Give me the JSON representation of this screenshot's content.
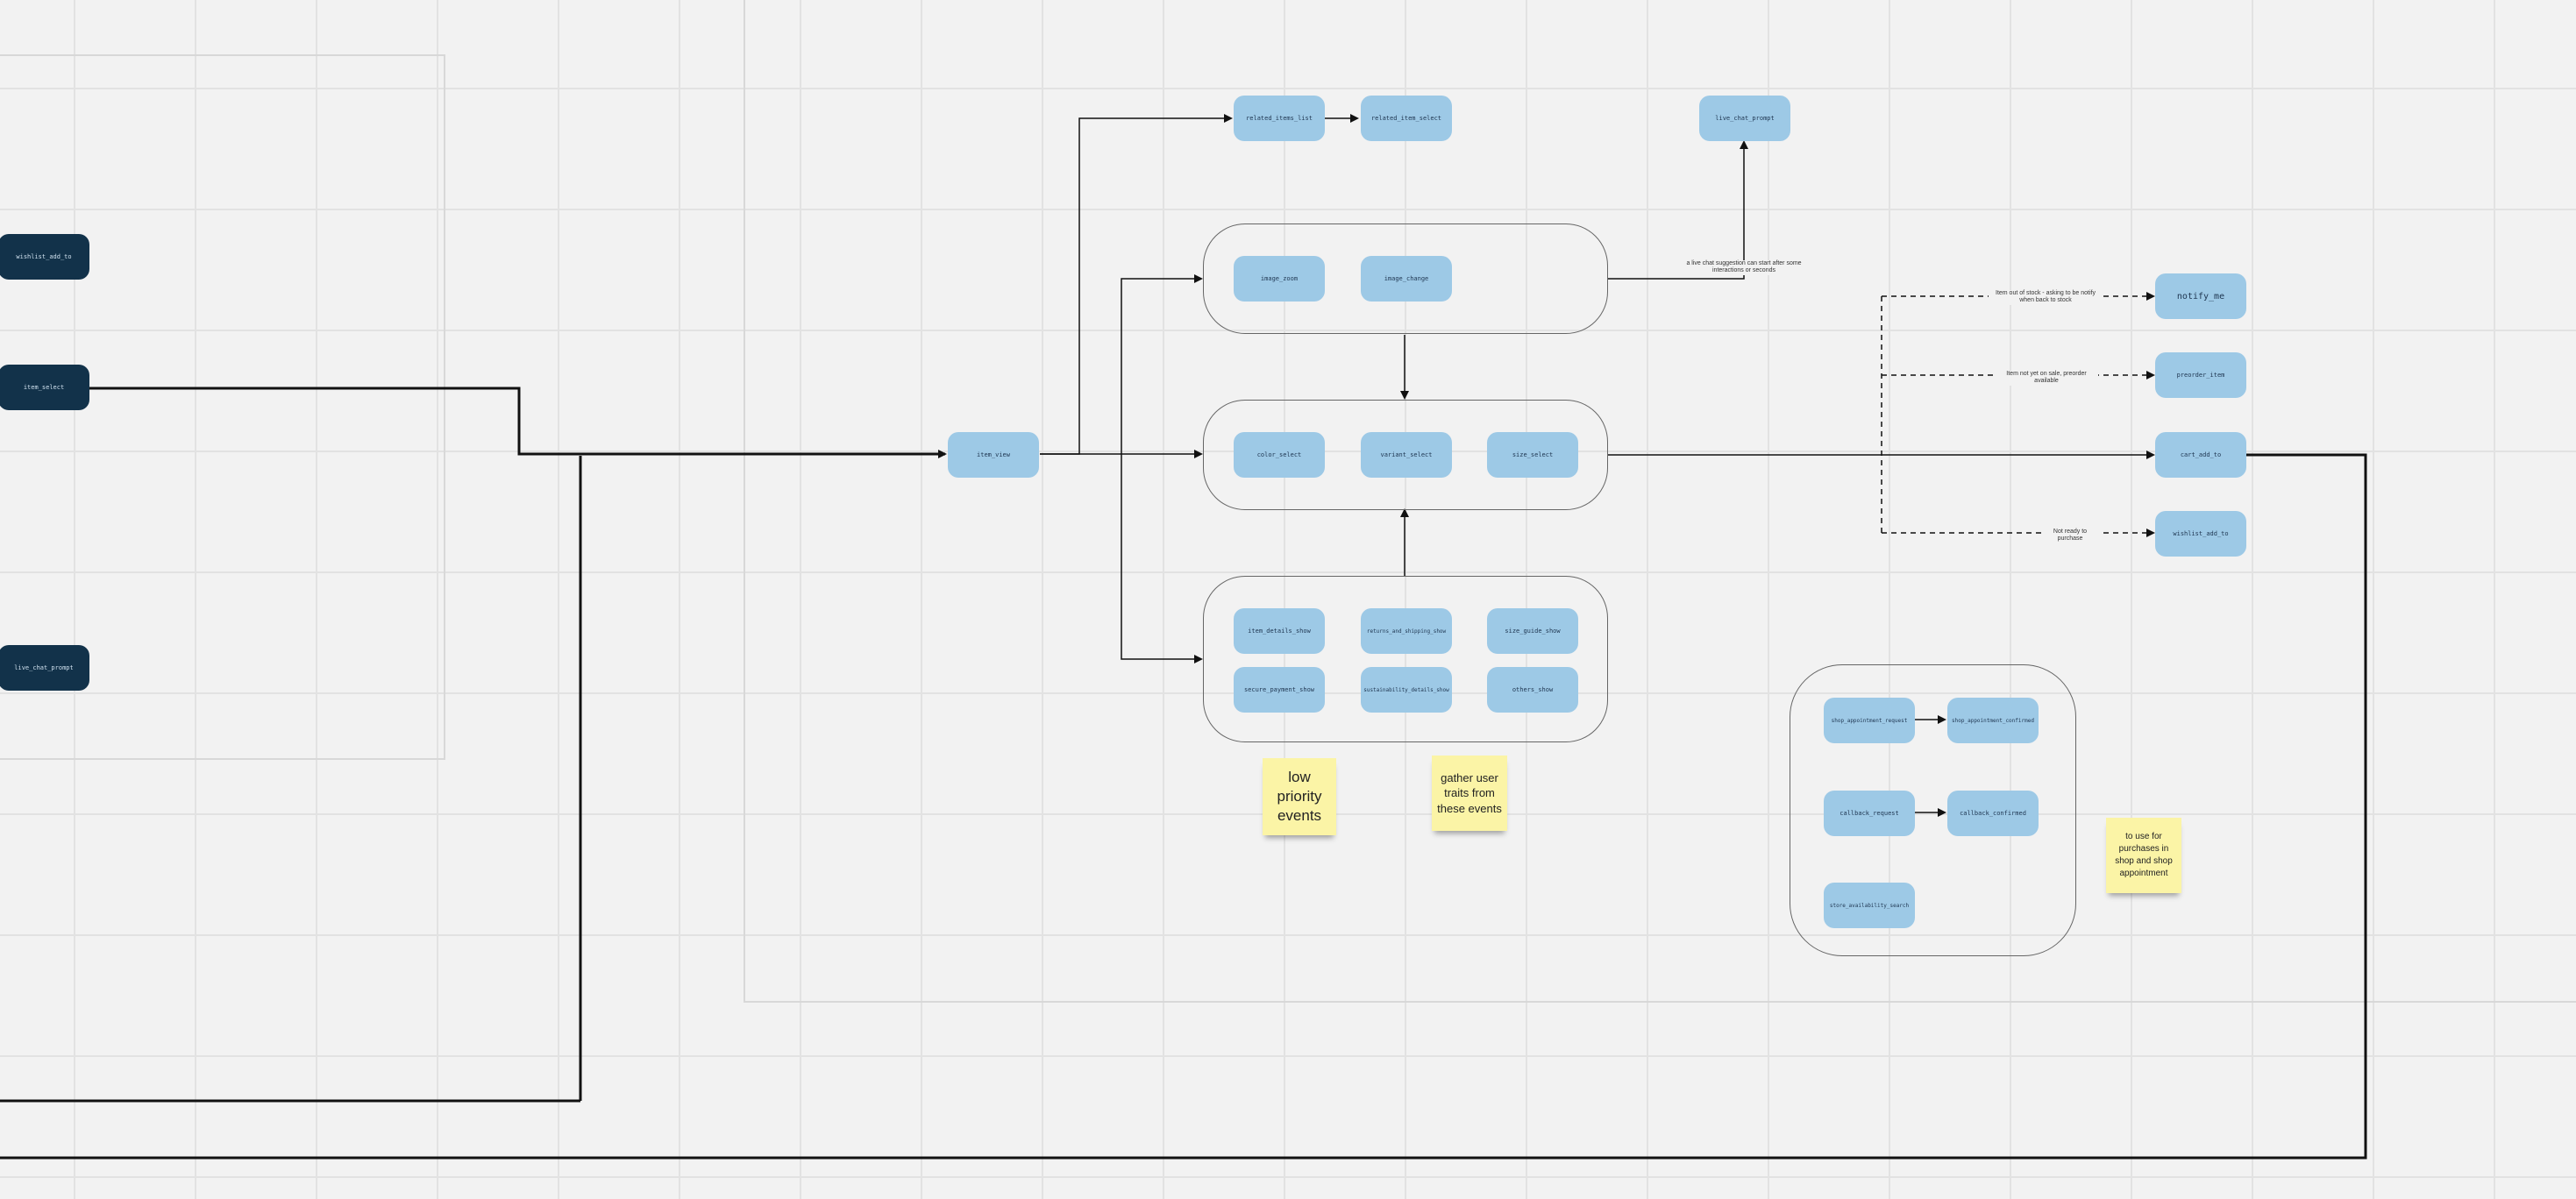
{
  "canvas": {
    "background": "#f2f2f2",
    "node_color": "#9dc9e6",
    "dark_node_color": "#12324a",
    "sticky_color": "#fbf4a6"
  },
  "left_frame": {
    "nodes": {
      "wishlist_add_to": "wishlist_add_to",
      "item_select": "item_select",
      "live_chat_prompt": "live_chat_prompt"
    }
  },
  "main_flow": {
    "item_view": "item_view",
    "related_items_list": "related_items_list",
    "related_item_select": "related_item_select",
    "live_chat_prompt": "live_chat_prompt",
    "image_group": {
      "image_zoom": "image_zoom",
      "image_change": "image_change"
    },
    "select_group": {
      "color_select": "color_select",
      "variant_select": "variant_select",
      "size_select": "size_select"
    },
    "details_group": {
      "item_details_show": "item_details_show",
      "returns_and_shipping_show": "returns_and_shipping_show",
      "size_guide_show": "size_guide_show",
      "secure_payment_show": "secure_payment_show",
      "sustainability_details_show": "sustainability_details_show",
      "others_show": "others_show"
    },
    "outcomes": {
      "notify_me": "notify_me",
      "preorder_item": "preorder_item",
      "cart_add_to": "cart_add_to",
      "wishlist_add_to": "wishlist_add_to"
    },
    "shop_group": {
      "shop_appointment_request": "shop_appointment_request",
      "shop_appointment_confirmed": "shop_appointment_confirmed",
      "callback_request": "callback_request",
      "callback_confirmed": "callback_confirmed",
      "store_availability_search": "store_availability_search"
    }
  },
  "edge_labels": {
    "live_chat": "a live chat suggestion can start after some interactions or seconds",
    "notify": "Item out of stock - asking to be notify when back to stock",
    "preorder": "Item not yet on sale, preorder available",
    "wishlist": "Not ready to purchase"
  },
  "stickies": {
    "low_priority": "low priority events",
    "gather_traits": "gather user traits from these events",
    "shop_purchases": "to use for purchases in shop and shop appointment"
  }
}
